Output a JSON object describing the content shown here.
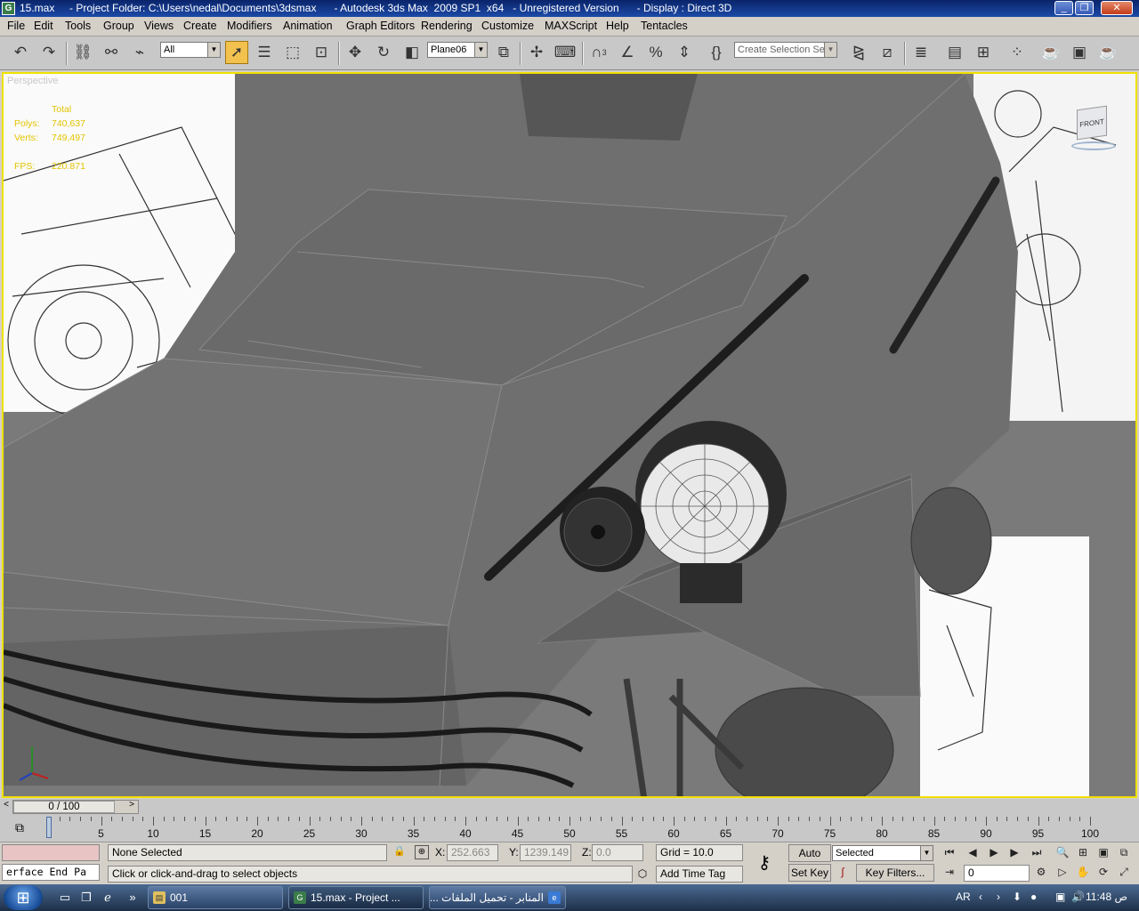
{
  "window": {
    "title": "15.max     - Project Folder: C:\\Users\\nedal\\Documents\\3dsmax      - Autodesk 3ds Max  2009 SP1  x64   - Unregistered Version      - Display : Direct 3D",
    "app_icon": "3dsmax-icon"
  },
  "menu": [
    "File",
    "Edit",
    "Tools",
    "Group",
    "Views",
    "Create",
    "Modifiers",
    "Animation",
    "Graph Editors",
    "Rendering",
    "Customize",
    "MAXScript",
    "Help",
    "Tentacles"
  ],
  "toolbar": {
    "selection_filter": "All",
    "reference_coord": "Plane06",
    "named_selection_placeholder": "Create Selection Set",
    "angle_snap_label": "3"
  },
  "viewport": {
    "label": "Perspective",
    "stats": {
      "header": "Total",
      "polys_label": "Polys:",
      "polys": "740,637",
      "verts_label": "Verts:",
      "verts": "749,497",
      "fps_label": "FPS:",
      "fps": "220.871"
    },
    "viewcube_label": "FRONT",
    "border_color": "#f0e000"
  },
  "timeslider": {
    "frame_display": "0 / 100"
  },
  "trackbar": {
    "ticks": [
      "0",
      "5",
      "10",
      "15",
      "20",
      "25",
      "30",
      "35",
      "40",
      "45",
      "50",
      "55",
      "60",
      "65",
      "70",
      "75",
      "80",
      "85",
      "90",
      "95",
      "100"
    ]
  },
  "status": {
    "maxscript_listener": "erface End Pa",
    "selection": "None Selected",
    "prompt": "Click or click-and-drag to select objects",
    "x_label": "X:",
    "x": "252.663",
    "y_label": "Y:",
    "y": "1239.149",
    "z_label": "Z:",
    "z": "0.0",
    "grid": "Grid = 10.0",
    "add_time_tag": "Add Time Tag",
    "auto_key": "Auto Key",
    "set_key": "Set Key",
    "key_mode": "Selected",
    "key_filters": "Key Filters...",
    "current_frame": "0"
  },
  "taskbar": {
    "tasks": [
      {
        "label": "001",
        "icon": "folder-icon"
      },
      {
        "label": "15.max     - Project ...",
        "icon": "3dsmax-icon"
      },
      {
        "label": "المنابر - تحميل الملفات ...",
        "icon": "ie-icon"
      }
    ],
    "language": "AR",
    "clock": "11:48 ص"
  }
}
